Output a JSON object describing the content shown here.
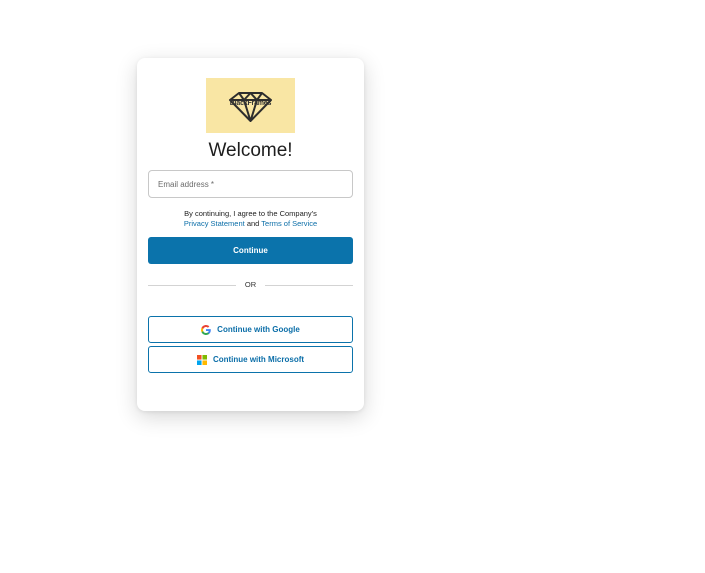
{
  "logo": {
    "text": "BlackFrames",
    "icon": "diamond-icon"
  },
  "welcome_title": "Welcome!",
  "email": {
    "placeholder": "Email address *",
    "value": ""
  },
  "legal": {
    "prefix": "By continuing, I agree to the Company's",
    "privacy_link": "Privacy Statement",
    "and": "and",
    "terms_link": "Terms of Service"
  },
  "continue_label": "Continue",
  "divider_label": "OR",
  "social": {
    "google_label": "Continue with Google",
    "microsoft_label": "Continue with Microsoft"
  },
  "colors": {
    "primary": "#0b73ab",
    "link": "#0b6ea8",
    "logo_bg": "#f9e6a4"
  }
}
